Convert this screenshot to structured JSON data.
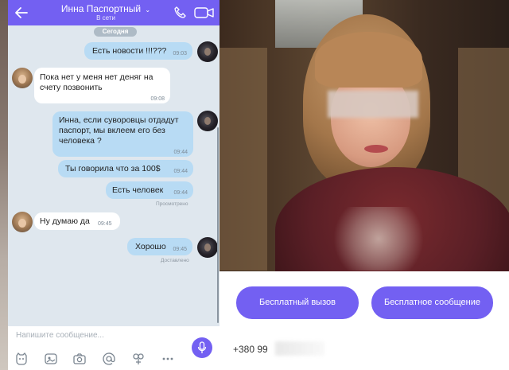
{
  "header": {
    "contact_name": "Инна Паспортный",
    "chevron": "⌄",
    "status": "В сети",
    "icons": [
      "back-arrow-icon",
      "phone-icon",
      "video-camera-icon"
    ]
  },
  "date_chip": "Сегодня",
  "messages": [
    {
      "direction": "out",
      "text": "Есть новости !!!???",
      "time": "09:03"
    },
    {
      "direction": "in",
      "text": "Пока нет у меня нет деняг на счету позвонить",
      "time": "09:08"
    },
    {
      "direction": "out",
      "text": "Инна, если суворовцы отдадут паспорт, мы вклеем его без человека ?",
      "time": "09:44"
    },
    {
      "direction": "out",
      "text": "Ты говорила что за 100$",
      "time": "09:44"
    },
    {
      "direction": "out",
      "text": "Есть человек",
      "time": "09:44",
      "meta": "Просмотрено"
    },
    {
      "direction": "in",
      "text": "Ну думаю да",
      "time": "09:45"
    },
    {
      "direction": "out",
      "text": "Хорошо",
      "time": "09:45",
      "meta": "Доставлено"
    }
  ],
  "composer": {
    "placeholder": "Напишите сообщение...",
    "tools": [
      "sticker-icon",
      "image-icon",
      "camera-icon",
      "mention-icon",
      "doodle-icon",
      "more-icon"
    ],
    "send_icon": "microphone-icon"
  },
  "profile": {
    "free_call_label": "Бесплатный вызов",
    "free_message_label": "Бесплатное сообщение",
    "phone_prefix": "+380 99"
  },
  "colors": {
    "accent": "#7360f2",
    "chat_background": "#dfe7ee",
    "outgoing_bubble": "#b8dbf4",
    "incoming_bubble": "#ffffff"
  }
}
